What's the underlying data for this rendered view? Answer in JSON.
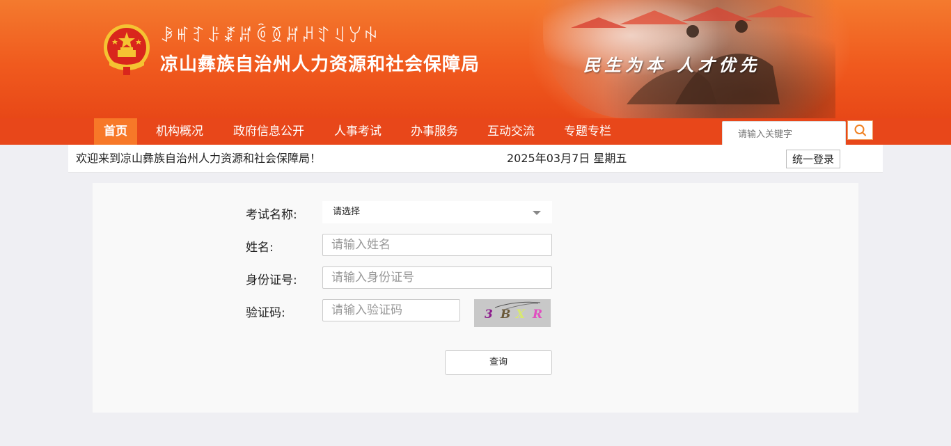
{
  "header": {
    "yi_title": "ꆃꎭꆈꌠꊨꏦꏱꅉꏦꈚꄸꆹꌦꑭ",
    "title": "凉山彝族自治州人力资源和社会保障局",
    "slogan": "民生为本  人才优先"
  },
  "nav": {
    "items": [
      "首页",
      "机构概况",
      "政府信息公开",
      "人事考试",
      "办事服务",
      "互动交流",
      "专题专栏"
    ],
    "active_index": 0
  },
  "search": {
    "placeholder": "请输入关键字",
    "icon": "search-icon"
  },
  "welcome": {
    "text": "欢迎来到凉山彝族自治州人力资源和社会保障局！",
    "date": "2025年03月7日 星期五",
    "login_label": "统一登录"
  },
  "form": {
    "exam_label": "考试名称:",
    "exam_selected": "请选择",
    "name_label": "姓名:",
    "name_placeholder": "请输入姓名",
    "id_label": "身份证号:",
    "id_placeholder": "请输入身份证号",
    "captcha_label": "验证码:",
    "captcha_placeholder": "请输入验证码",
    "captcha_chars": [
      "3",
      "B",
      "X",
      "R"
    ],
    "submit_label": "查询"
  },
  "colors": {
    "header": "#f05a1e",
    "nav": "#e8471a",
    "nav_active": "#f77828",
    "page_bg": "#efeff3",
    "panel_bg": "#f9f9f9"
  }
}
